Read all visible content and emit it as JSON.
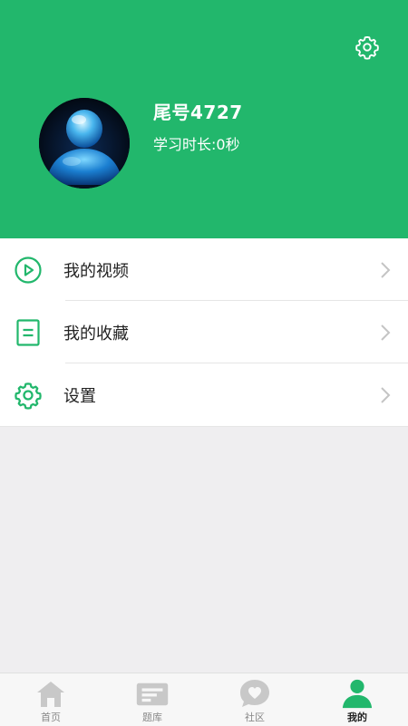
{
  "profile": {
    "username": "尾号4727",
    "study_time": "学习时长:0秒"
  },
  "header": {
    "settings_icon": "gear-outline-icon",
    "background_color": "#22b76c"
  },
  "menu": {
    "items": [
      {
        "label": "我的视频",
        "icon": "play-circle-icon"
      },
      {
        "label": "我的收藏",
        "icon": "document-icon"
      },
      {
        "label": "设置",
        "icon": "gear-icon"
      }
    ]
  },
  "tabbar": {
    "tabs": [
      {
        "label": "首页",
        "icon": "home-icon",
        "active": false
      },
      {
        "label": "题库",
        "icon": "question-bank-icon",
        "active": false
      },
      {
        "label": "社区",
        "icon": "community-heart-icon",
        "active": false
      },
      {
        "label": "我的",
        "icon": "profile-icon",
        "active": true
      }
    ],
    "active_color": "#22b76c",
    "inactive_color": "#c8c8c8"
  }
}
